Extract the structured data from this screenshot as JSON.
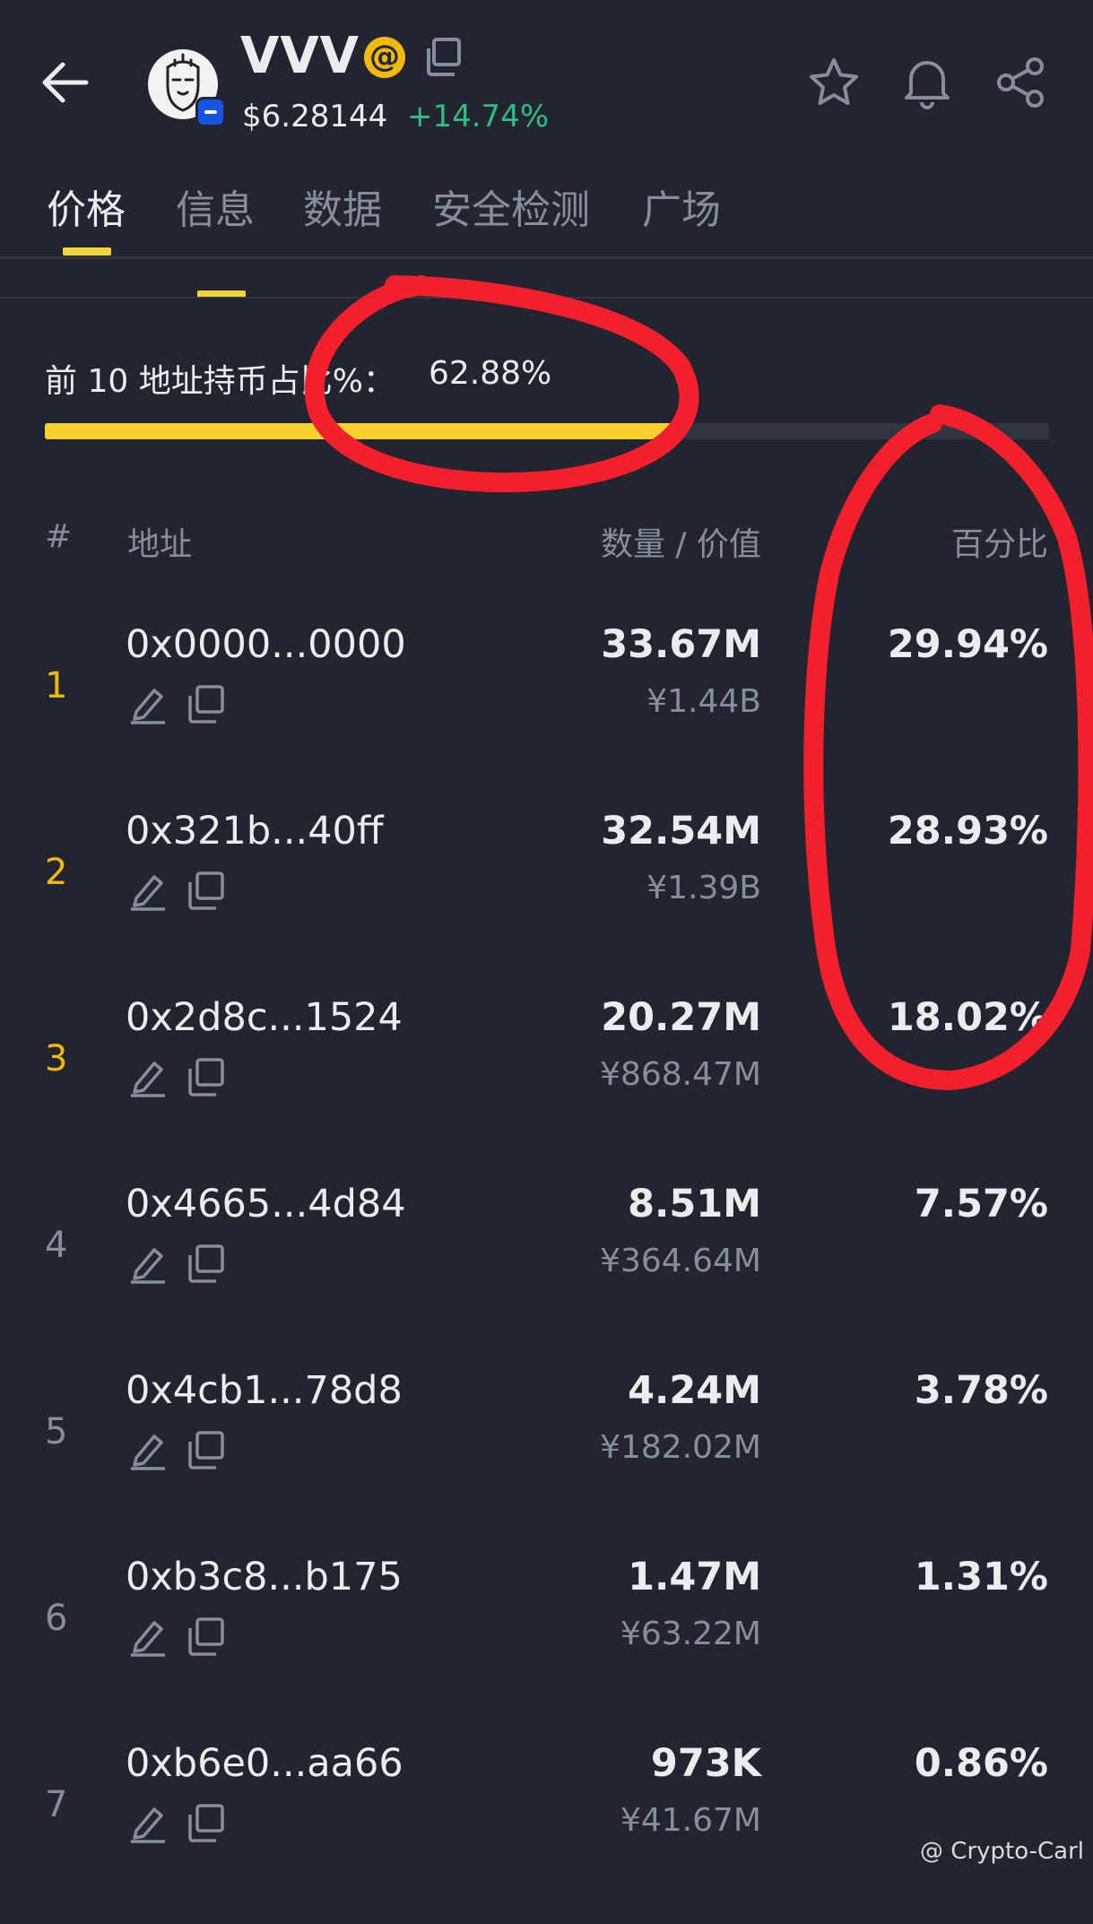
{
  "header": {
    "coin_name": "VVV",
    "at_symbol": "@",
    "price": "$6.28144",
    "change": "+14.74%"
  },
  "tabs": [
    {
      "label": "价格",
      "active": true
    },
    {
      "label": "信息",
      "active": false
    },
    {
      "label": "数据",
      "active": false
    },
    {
      "label": "安全检测",
      "active": false
    },
    {
      "label": "广场",
      "active": false
    }
  ],
  "summary": {
    "label": "前 10 地址持币占比%：",
    "value": "62.88%",
    "fraction": 0.6288
  },
  "table": {
    "headers": {
      "rank": "#",
      "address": "地址",
      "qty_value": "数量 / 价值",
      "percent": "百分比"
    },
    "rows": [
      {
        "rank": "1",
        "address": "0x0000...0000",
        "qty": "33.67M",
        "value": "¥1.44B",
        "pct": "29.94%"
      },
      {
        "rank": "2",
        "address": "0x321b...40ff",
        "qty": "32.54M",
        "value": "¥1.39B",
        "pct": "28.93%"
      },
      {
        "rank": "3",
        "address": "0x2d8c...1524",
        "qty": "20.27M",
        "value": "¥868.47M",
        "pct": "18.02%"
      },
      {
        "rank": "4",
        "address": "0x4665...4d84",
        "qty": "8.51M",
        "value": "¥364.64M",
        "pct": "7.57%"
      },
      {
        "rank": "5",
        "address": "0x4cb1...78d8",
        "qty": "4.24M",
        "value": "¥182.02M",
        "pct": "3.78%"
      },
      {
        "rank": "6",
        "address": "0xb3c8...b175",
        "qty": "1.47M",
        "value": "¥63.22M",
        "pct": "1.31%"
      },
      {
        "rank": "7",
        "address": "0xb6e0...aa66",
        "qty": "973K",
        "value": "¥41.67M",
        "pct": "0.86%"
      }
    ]
  },
  "watermark": "@ Crypto-Carl",
  "colors": {
    "background": "#22252f",
    "accent_yellow": "#f0b90b",
    "positive_green": "#2ebd85",
    "annotation_red": "#f21f2d"
  }
}
